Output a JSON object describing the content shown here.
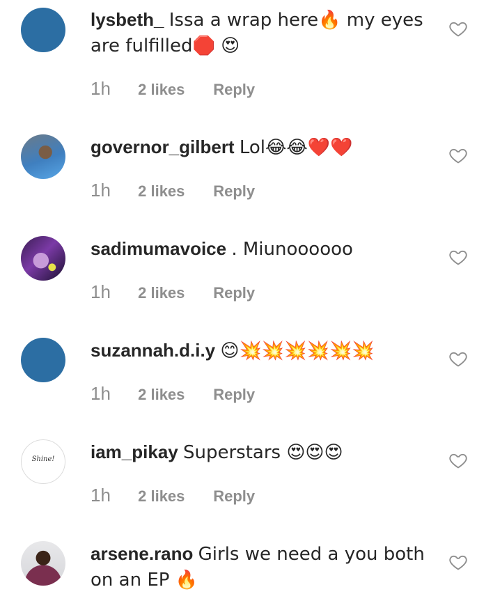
{
  "comments": [
    {
      "username": "lysbeth_",
      "text": "Issa a wrap here🔥 my eyes are fulfilled🛑 😍",
      "time": "1h",
      "likes": "2 likes",
      "reply": "Reply",
      "avatar": "plain-blue"
    },
    {
      "username": "governor_gilbert",
      "text": "Lol😂😂❤️❤️",
      "time": "1h",
      "likes": "2 likes",
      "reply": "Reply",
      "avatar": "photo"
    },
    {
      "username": "sadimumavoice",
      "text": ". Miunoooooo",
      "time": "1h",
      "likes": "2 likes",
      "reply": "Reply",
      "avatar": "photo"
    },
    {
      "username": "suzannah.d.i.y",
      "text": "😊💥💥💥💥💥💥",
      "time": "1h",
      "likes": "2 likes",
      "reply": "Reply",
      "avatar": "plain-blue"
    },
    {
      "username": "iam_pikay",
      "text": "Superstars 😍😍😍",
      "time": "1h",
      "likes": "2 likes",
      "reply": "Reply",
      "avatar": "logo",
      "avatar_text": "Shine!"
    },
    {
      "username": "arsene.rano",
      "text": "Girls we need a you both on an EP 🔥",
      "avatar": "photo"
    }
  ],
  "icons": {
    "like": "heart-outline-icon"
  },
  "colors": {
    "avatar_blue": "#2c6ea3",
    "meta_gray": "#8e8e8e",
    "text": "#262626"
  }
}
